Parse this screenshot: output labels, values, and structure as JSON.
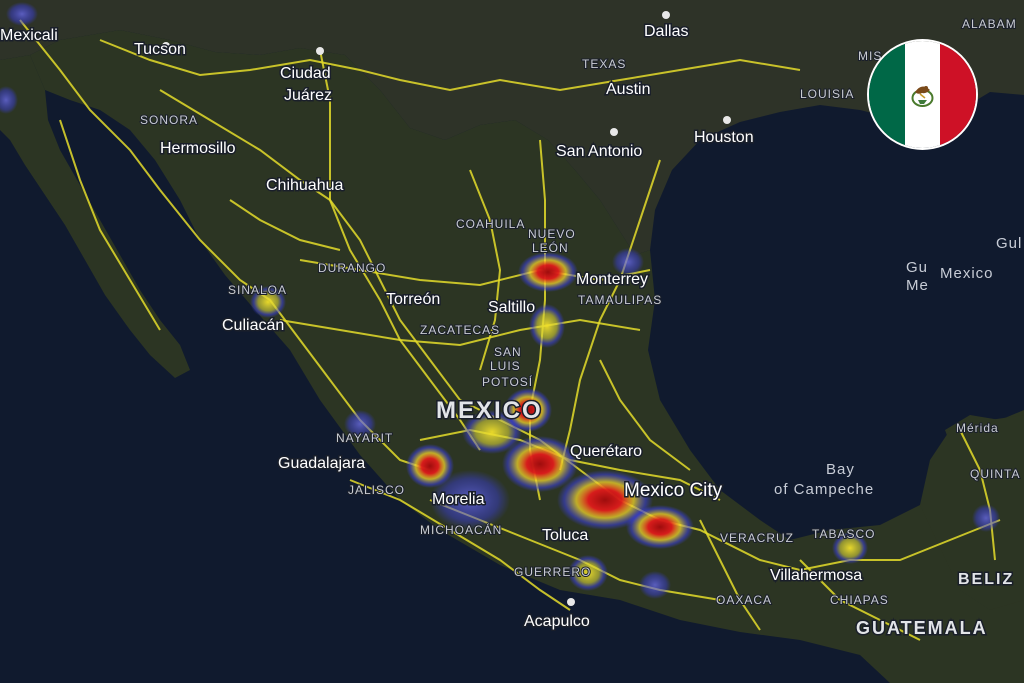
{
  "colors": {
    "ocean": "#101a2e",
    "land": "#2a3224",
    "roads": "#e4dc2a",
    "heat_low": "#3b3fe0",
    "heat_mid": "#e8e02a",
    "heat_high": "#d41b1b",
    "flag_green": "#006847",
    "flag_white": "#ffffff",
    "flag_red": "#ce1126"
  },
  "labels": {
    "cities": {
      "mexicali": "Mexicali",
      "tucson": "Tucson",
      "ciudad": "Ciudad",
      "juarez": "Juárez",
      "dallas": "Dallas",
      "austin": "Austin",
      "san_antonio": "San Antonio",
      "houston": "Houston",
      "hermosillo": "Hermosillo",
      "chihuahua": "Chihuahua",
      "monterrey": "Monterrey",
      "saltillo": "Saltillo",
      "torreon": "Torreón",
      "culiacan": "Culiacán",
      "guadalajara": "Guadalajara",
      "morelia": "Morelia",
      "queretaro": "Querétaro",
      "mexico_city": "Mexico City",
      "toluca": "Toluca",
      "acapulco": "Acapulco",
      "villahermosa": "Villahermosa"
    },
    "regions": {
      "sonora": "SONORA",
      "texas": "TEXAS",
      "alabama": "ALABAM",
      "mississippi": "MIS",
      "louisiana": "LOUISIA",
      "coahuila": "COAHUILA",
      "nuevo_leon_1": "NUEVO",
      "nuevo_leon_2": "LEÓN",
      "durango": "DURANGO",
      "sinaloa": "SINALOA",
      "tamaulipas": "TAMAULIPAS",
      "zacatecas": "ZACATECAS",
      "slp_1": "SAN",
      "slp_2": "LUIS",
      "slp_3": "POTOSÍ",
      "nayarit": "NAYARIT",
      "jalisco": "JALISCO",
      "michoacan": "MICHOACÁN",
      "guerrero": "GUERRERO",
      "oaxaca": "OAXACA",
      "veracruz": "VERACRUZ",
      "tabasco": "TABASCO",
      "chiapas": "CHIAPAS",
      "merida": "Mérida",
      "quintana": "QUINTA"
    },
    "countries": {
      "mexico": "MEXICO",
      "belize": "BELIZ",
      "guatemala": "GUATEMALA"
    },
    "water": {
      "bay_1": "Bay",
      "bay_2": "of Campeche",
      "gulf_1": "Gu",
      "gulf_2": "Me",
      "gulf_3": "Mexico",
      "gulf_edge": "Gul"
    }
  },
  "heatmap": {
    "hotspots": [
      {
        "name": "Monterrey",
        "intensity": "high"
      },
      {
        "name": "Guadalajara",
        "intensity": "high"
      },
      {
        "name": "León / Bajío",
        "intensity": "high"
      },
      {
        "name": "Mexico City corridor",
        "intensity": "high"
      },
      {
        "name": "Puebla",
        "intensity": "high"
      },
      {
        "name": "San Luis Potosí",
        "intensity": "high"
      },
      {
        "name": "Culiacán",
        "intensity": "medium"
      },
      {
        "name": "Saltillo",
        "intensity": "medium"
      },
      {
        "name": "Acapulco region",
        "intensity": "medium"
      },
      {
        "name": "Villahermosa",
        "intensity": "medium"
      }
    ]
  },
  "flag": {
    "icon": "mexico-flag-icon"
  }
}
